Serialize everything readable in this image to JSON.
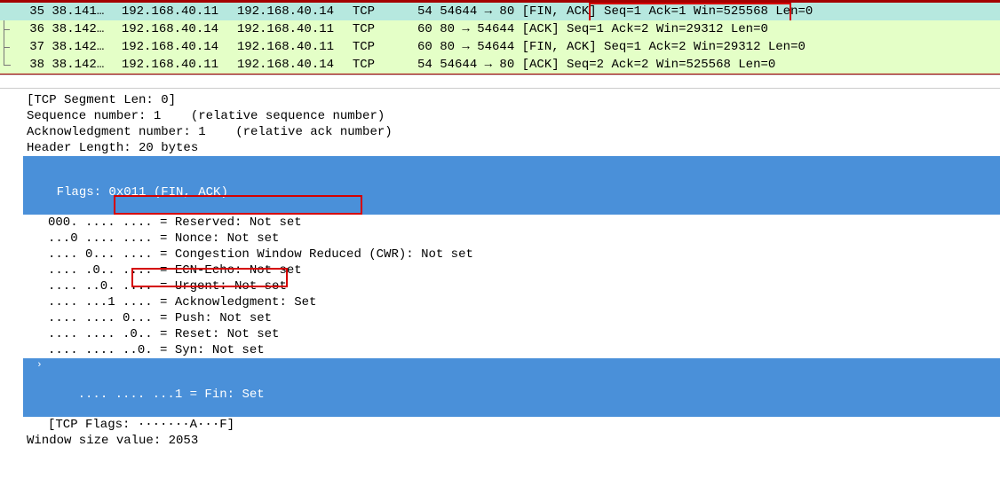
{
  "packets": [
    {
      "no": "35",
      "time": "38.141",
      "src": "192.168.40.11",
      "dst": "192.168.40.14",
      "proto": "TCP",
      "len": "54",
      "info": "54644 → 80 [FIN, ACK] Seq=1 Ack=1 Win=525568 Len=0"
    },
    {
      "no": "36",
      "time": "38.142",
      "src": "192.168.40.14",
      "dst": "192.168.40.11",
      "proto": "TCP",
      "len": "60",
      "info": "80 → 54644 [ACK] Seq=1 Ack=2 Win=29312 Len=0"
    },
    {
      "no": "37",
      "time": "38.142",
      "src": "192.168.40.14",
      "dst": "192.168.40.11",
      "proto": "TCP",
      "len": "60",
      "info": "80 → 54644 [FIN, ACK] Seq=1 Ack=2 Win=29312 Len=0"
    },
    {
      "no": "38",
      "time": "38.142",
      "src": "192.168.40.11",
      "dst": "192.168.40.14",
      "proto": "TCP",
      "len": "54",
      "info": "54644 → 80 [ACK] Seq=2 Ack=2 Win=525568 Len=0"
    }
  ],
  "details": {
    "seg_len": "[TCP Segment Len: 0]",
    "seq": "Sequence number: 1    (relative sequence number)",
    "ack": "Acknowledgment number: 1    (relative ack number)",
    "hdr_len": "Header Length: 20 bytes",
    "flags_hdr": "Flags: 0x011 (FIN, ACK)",
    "reserved": "000. .... .... = Reserved: Not set",
    "nonce": "...0 .... .... = Nonce: Not set",
    "cwr": ".... 0... .... = Congestion Window Reduced (CWR): Not set",
    "ecn": ".... .0.. .... = ECN-Echo: Not set",
    "urg": ".... ..0. .... = Urgent: Not set",
    "ackflag": ".... ...1 .... = Acknowledgment: Set",
    "push": ".... .... 0... = Push: Not set",
    "reset": ".... .... .0.. = Reset: Not set",
    "syn": ".... .... ..0. = Syn: Not set",
    "fin": ".... .... ...1 = Fin: Set",
    "tcpflags": "[TCP Flags: ·······A···F]",
    "winsize": "Window size value: 2053"
  },
  "glyphs": {
    "chev_down": "⌄",
    "chev_right": "›"
  }
}
